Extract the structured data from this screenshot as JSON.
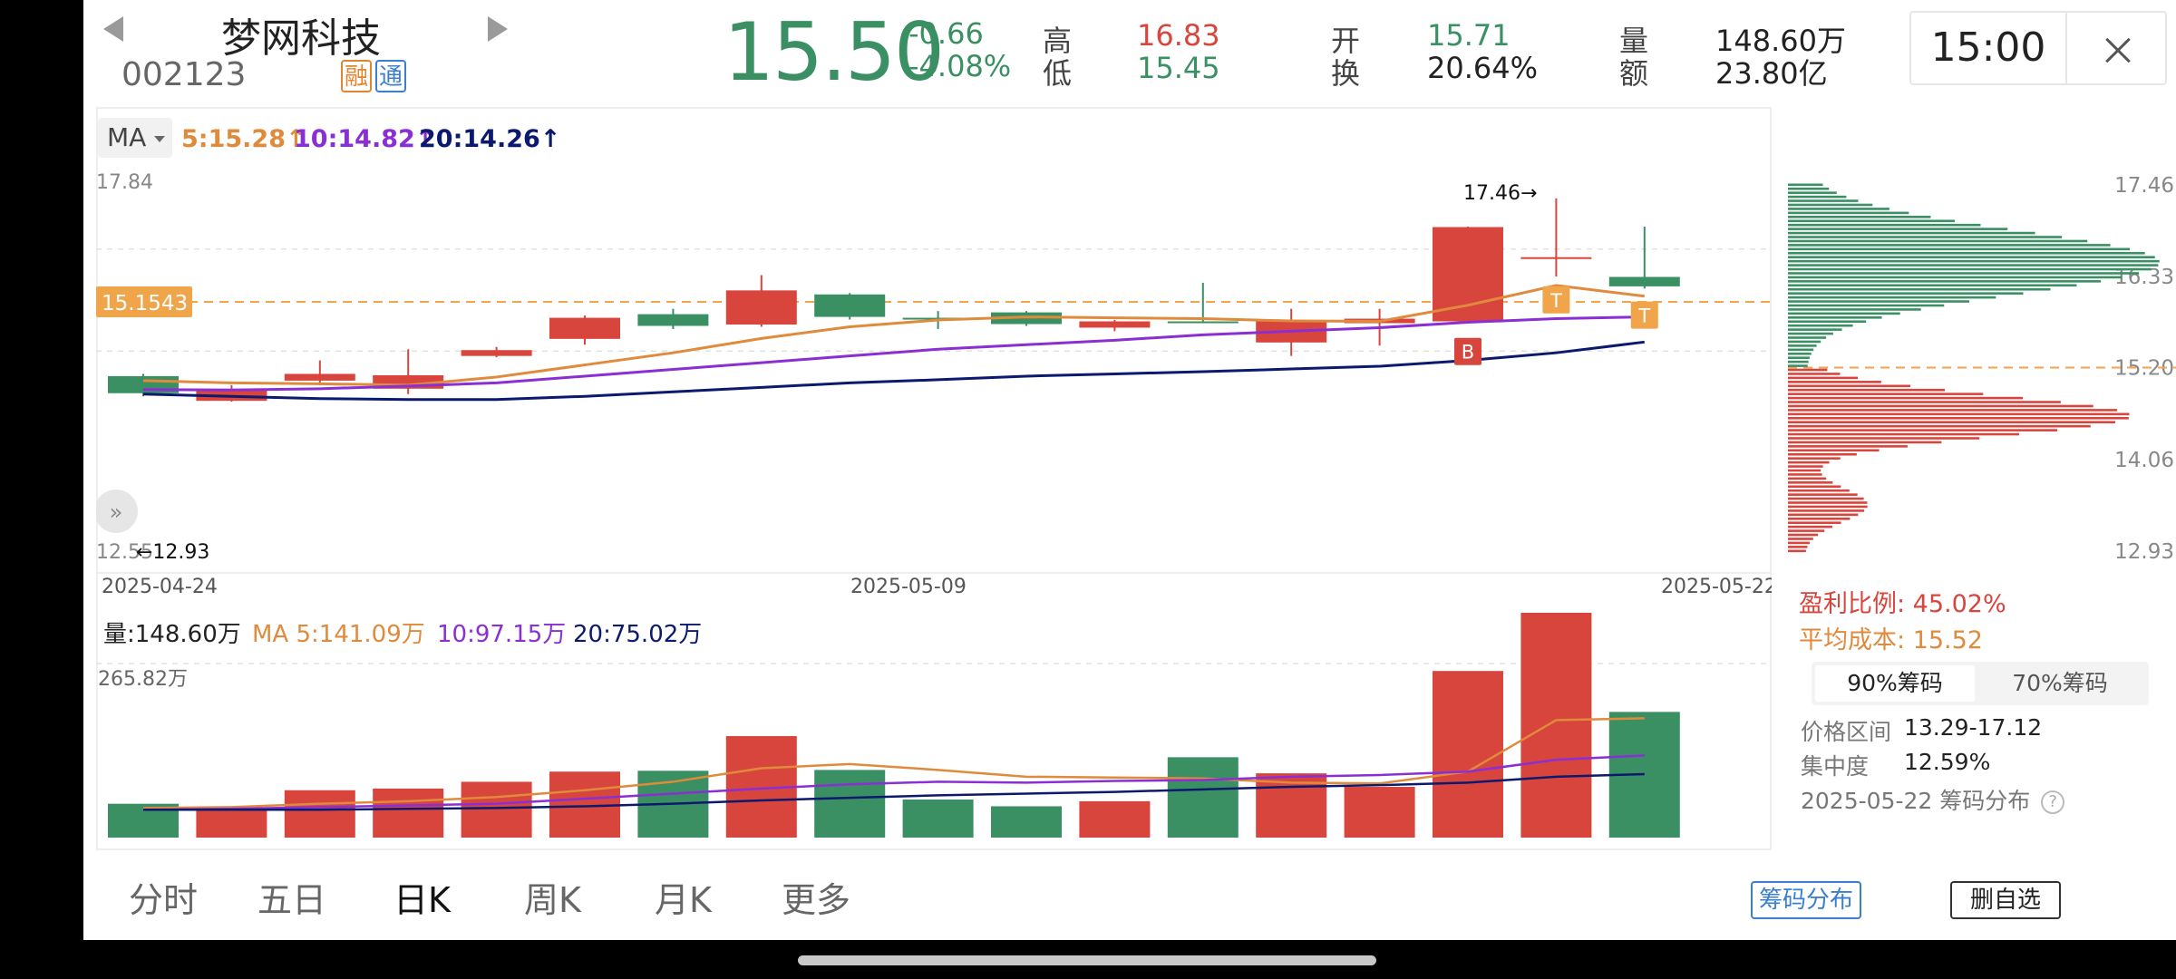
{
  "stock": {
    "name": "梦网科技",
    "code": "002123",
    "tag_rong": "融",
    "tag_tong": "通",
    "price": "15.50",
    "change": "-0.66",
    "change_pct": "-4.08%"
  },
  "stats": {
    "high_label": "高",
    "high": "16.83",
    "low_label": "低",
    "low": "15.45",
    "open_label": "开",
    "open": "15.71",
    "turnover_label": "换",
    "turnover": "20.64%",
    "volume_label": "量",
    "volume": "148.60万",
    "amount_label": "额",
    "amount": "23.80亿"
  },
  "time": "15:00",
  "ma_bar": {
    "selector": "MA",
    "ma5": "5:15.28↑",
    "ma10": "10:14.82↑",
    "ma20": "20:14.26↑"
  },
  "volume_bar": {
    "label": "量:148.60万",
    "ma5": "MA 5:141.09万",
    "ma10": "10:97.15万",
    "ma20": "20:75.02万",
    "axis_max": "265.82万"
  },
  "price_axis": {
    "top": "17.84",
    "bottom": "12.55",
    "marker": "15.1543",
    "high_note": "17.46→",
    "low_note": "←12.93"
  },
  "dates": [
    "2025-04-24",
    "2025-05-09",
    "2025-05-22"
  ],
  "signals": [
    "T",
    "T",
    "B"
  ],
  "chip": {
    "axis": [
      "17.46",
      "16.33",
      "15.20",
      "14.06",
      "12.93"
    ],
    "profit_ratio": "盈利比例: 45.02%",
    "avg_cost": "平均成本: 15.52",
    "tab_90": "90%筹码",
    "tab_70": "70%筹码",
    "range_label": "价格区间",
    "range_value": "13.29-17.12",
    "concentration_label": "集中度",
    "concentration_value": "12.59%",
    "date_note": "2025-05-22 筹码分布",
    "help": "?"
  },
  "period_tabs": [
    "分时",
    "五日",
    "日K",
    "周K",
    "月K",
    "更多"
  ],
  "buttons": {
    "chip_distribution": "筹码分布",
    "remove_watchlist": "删自选"
  },
  "colors": {
    "up": "#d8453d",
    "down": "#3a8f63",
    "ma5": "#e08a3c",
    "ma10": "#8a2fd4",
    "ma20": "#0b1a6e",
    "marker": "#f0a54a"
  },
  "chart_data": {
    "type": "candlestick",
    "x": [
      "2025-04-24",
      "2025-04-25",
      "2025-04-28",
      "2025-04-29",
      "2025-04-30",
      "2025-05-06",
      "2025-05-07",
      "2025-05-08",
      "2025-05-09",
      "2025-05-12",
      "2025-05-13",
      "2025-05-14",
      "2025-05-15",
      "2025-05-16",
      "2025-05-19",
      "2025-05-20",
      "2025-05-21",
      "2025-05-22"
    ],
    "candles": [
      {
        "open": 13.5,
        "close": 13.12,
        "high": 13.55,
        "low": 13.05
      },
      {
        "open": 12.95,
        "close": 13.22,
        "high": 13.3,
        "low": 12.93
      },
      {
        "open": 13.4,
        "close": 13.55,
        "high": 13.85,
        "low": 13.3
      },
      {
        "open": 13.22,
        "close": 13.52,
        "high": 14.1,
        "low": 13.1
      },
      {
        "open": 13.95,
        "close": 14.08,
        "high": 14.15,
        "low": 13.92
      },
      {
        "open": 14.33,
        "close": 14.8,
        "high": 14.85,
        "low": 14.2
      },
      {
        "open": 14.88,
        "close": 14.62,
        "high": 15.0,
        "low": 14.55
      },
      {
        "open": 14.65,
        "close": 15.41,
        "high": 15.75,
        "low": 14.6
      },
      {
        "open": 15.32,
        "close": 14.82,
        "high": 15.35,
        "low": 14.76
      },
      {
        "open": 14.8,
        "close": 14.76,
        "high": 14.95,
        "low": 14.55
      },
      {
        "open": 14.92,
        "close": 14.66,
        "high": 14.95,
        "low": 14.62
      },
      {
        "open": 14.58,
        "close": 14.72,
        "high": 14.75,
        "low": 14.5
      },
      {
        "open": 14.72,
        "close": 14.7,
        "high": 15.58,
        "low": 14.68
      },
      {
        "open": 14.25,
        "close": 14.72,
        "high": 15.0,
        "low": 13.95
      },
      {
        "open": 14.68,
        "close": 14.78,
        "high": 15.0,
        "low": 14.18
      },
      {
        "open": 14.72,
        "close": 16.82,
        "high": 16.83,
        "low": 14.72
      },
      {
        "open": 16.15,
        "close": 16.15,
        "high": 17.46,
        "low": 15.72
      },
      {
        "open": 15.71,
        "close": 15.5,
        "high": 16.83,
        "low": 15.45
      }
    ],
    "ma5": [
      13.4,
      13.35,
      13.33,
      13.3,
      13.48,
      13.75,
      14.02,
      14.34,
      14.6,
      14.75,
      14.82,
      14.8,
      14.78,
      14.73,
      14.72,
      15.08,
      15.52,
      15.28
    ],
    "ma10": [
      13.2,
      13.19,
      13.22,
      13.28,
      13.35,
      13.5,
      13.65,
      13.8,
      13.95,
      14.1,
      14.2,
      14.3,
      14.42,
      14.5,
      14.58,
      14.7,
      14.78,
      14.82
    ],
    "ma20": [
      13.1,
      13.05,
      13.0,
      12.98,
      12.98,
      13.05,
      13.15,
      13.25,
      13.35,
      13.42,
      13.5,
      13.55,
      13.6,
      13.66,
      13.72,
      13.85,
      14.02,
      14.26
    ],
    "volume": [
      40,
      34,
      56,
      58,
      66,
      78,
      79,
      120,
      80,
      45,
      37,
      43,
      95,
      76,
      60,
      197,
      265.82,
      148.6
    ],
    "volume_ma5": [
      35,
      36,
      40,
      43,
      48,
      56,
      66,
      82,
      87,
      80,
      72,
      71,
      70,
      65,
      64,
      78,
      139,
      141.09
    ],
    "volume_ma10": [
      33,
      34,
      36,
      38,
      40,
      46,
      52,
      58,
      63,
      66,
      65,
      67,
      68,
      72,
      74,
      78,
      92,
      97.15
    ],
    "volume_ma20": [
      33,
      33,
      33,
      34,
      35,
      37,
      40,
      44,
      47,
      50,
      52,
      54,
      57,
      60,
      62,
      65,
      72,
      75.02
    ],
    "ylim": [
      12.55,
      17.84
    ]
  }
}
